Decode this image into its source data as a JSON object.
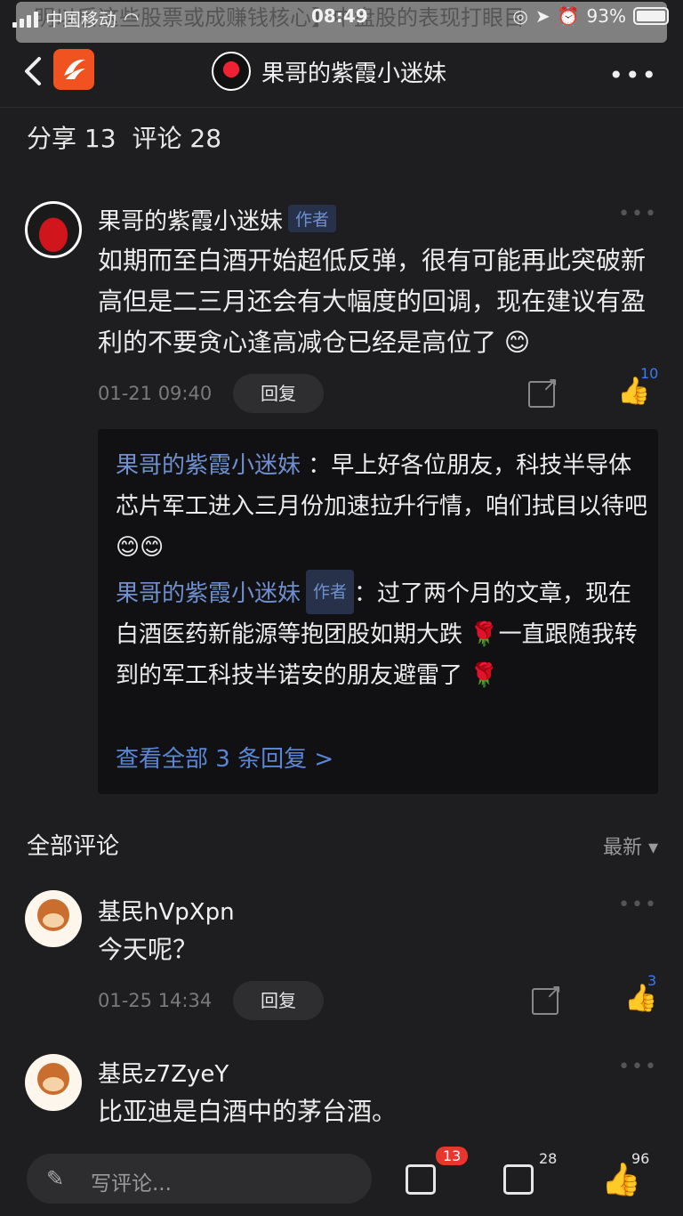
{
  "status": {
    "carrier": "中国移动",
    "time": "08:49",
    "battery": "93%",
    "banner": "明以后这些股票或成赚钱核心】中盘股的表现打眼目"
  },
  "nav": {
    "title": "果哥的紫霞小迷妹"
  },
  "counts": {
    "share": "分享 13",
    "comments": "评论 28"
  },
  "main_comment": {
    "name": "果哥的紫霞小迷妹",
    "tag": "作者",
    "text": "如期而至白酒开始超低反弹，很有可能再此突破新高但是二三月还会有大幅度的回调，现在建议有盈利的不要贪心逢高减仓已经是高位了 😊",
    "time": "01-21 09:40",
    "reply_label": "回复",
    "likes": "10"
  },
  "replies": {
    "r1_name": "果哥的紫霞小迷妹",
    "r1_text": " ：早上好各位朋友，科技半导体芯片军工进入三月份加速拉升行情，咱们拭目以待吧 😊😊",
    "r2_name": "果哥的紫霞小迷妹",
    "r2_tag": "作者",
    "r2_text": "：过了两个月的文章，现在白酒医药新能源等抱团股如期大跌 🌹一直跟随我转到的军工科技半诺安的朋友避雷了 🌹",
    "more": "查看全部 3 条回复 >"
  },
  "section": {
    "title": "全部评论",
    "sort": "最新 ▾"
  },
  "comments": [
    {
      "name": "基民hVpXpn",
      "text": "今天呢？",
      "time": "01-25 14:34",
      "reply_label": "回复",
      "likes": "3"
    },
    {
      "name": "基民z7ZyeY",
      "text": "比亚迪是白酒中的茅台酒。"
    }
  ],
  "bottom": {
    "placeholder": "写评论...",
    "share_count": "13",
    "comment_count": "28",
    "like_count": "96"
  }
}
